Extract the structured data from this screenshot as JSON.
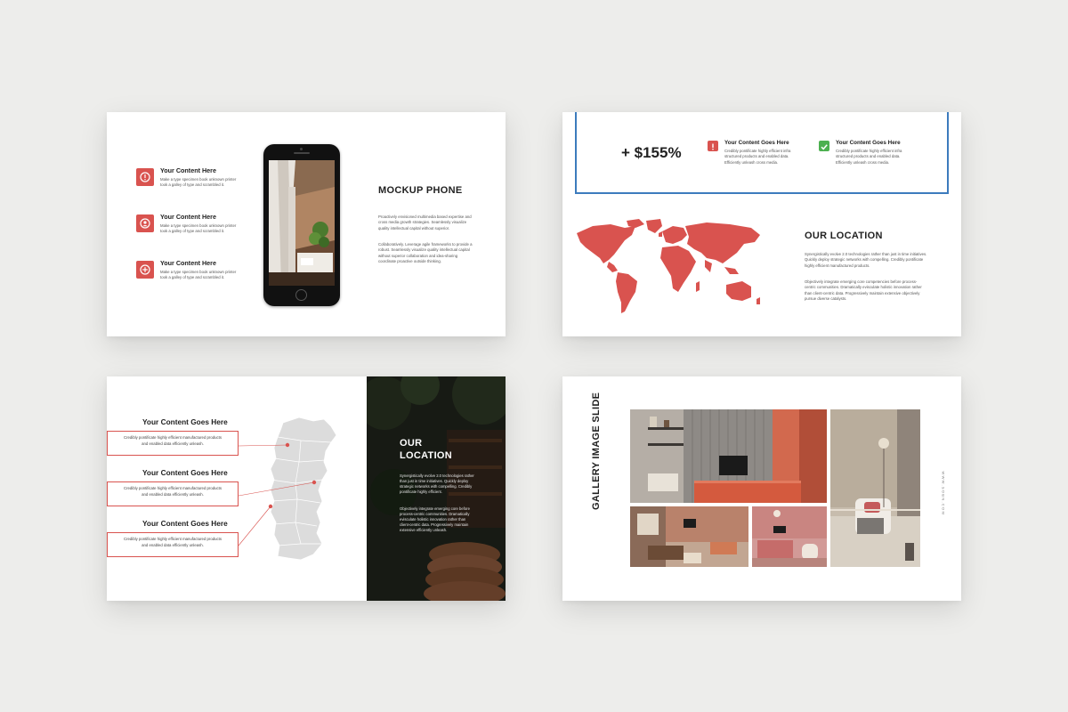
{
  "slide_mockup": {
    "items": [
      {
        "title": "Your Content Here",
        "text_line1": "Make a type specimen book unknown printer",
        "text_line2": "took a galley of type and scrambled it.",
        "icon": "exclamation-icon"
      },
      {
        "title": "Your Content Here",
        "text_line1": "Make a type specimen book unknown printer",
        "text_line2": "took a galley of type and scrambled it.",
        "icon": "user-icon"
      },
      {
        "title": "Your Content Here",
        "text_line1": "Make a type specimen book unknown printer",
        "text_line2": "took a galley of type and scrambled it.",
        "icon": "plus-icon"
      }
    ],
    "heading": "MOCKUP PHONE",
    "para1": [
      "Proactively envisioned multimedia based expertise and",
      "cross media growth strategies. Seamlessly visualize",
      "quality intellectual capital without superior."
    ],
    "para2": [
      "Collaboratively. Leverage agile frameworks to provide a",
      "robust. Seamlessly visualize quality intellectual capital",
      "without superior collaboration and idea-sharing",
      "coordinate proactive outside thinking."
    ]
  },
  "slide_location_world": {
    "stat": "+ $155%",
    "items": [
      {
        "title": "Your Content Goes Here",
        "lines": [
          "Credibly pontificate highly efficient infra",
          "structured products and enabled data.",
          "Efficiently unleash cross media."
        ],
        "icon": "alert-icon"
      },
      {
        "title": "Your Content Goes Here",
        "lines": [
          "Credibly pontificate highly efficient infra",
          "structured products and enabled data.",
          "Efficiently unleash cross media."
        ],
        "icon": "check-icon"
      }
    ],
    "heading": "OUR LOCATION",
    "para1": [
      "Synergistically evolve 2.0 technologies rather than just in time initiatives.",
      "Quickly deploy strategic networks with compelling. Credibly pontificate",
      "highly efficient manufactured products."
    ],
    "para2": [
      "Objectively integrate emerging core competencies before process-",
      "centric communities. Dramatically evisculate holistic innovation rather",
      "than client-centric data. Progressively maintain extensive objectively",
      "pursue diverse catalysts."
    ]
  },
  "slide_location_map": {
    "items": [
      {
        "title": "Your Content Goes Here",
        "line1": "Credibly pontificate highly efficient manufactured products",
        "line2": "and enabled data efficiently unleash."
      },
      {
        "title": "Your Content Goes Here",
        "line1": "Credibly pontificate highly efficient manufactured products",
        "line2": "and enabled data efficiently unleash."
      },
      {
        "title": "Your Content Goes Here",
        "line1": "Credibly pontificate highly efficient manufactured products",
        "line2": "and enabled data efficiently unleash."
      }
    ],
    "heading_line1": "OUR",
    "heading_line2": "LOCATION",
    "para1": [
      "Synergistically evolve 2.0 technologies rather",
      "than just in time initiatives. Quickly deploy",
      "strategic networks with compelling. Credibly",
      "pontificate highly efficient."
    ],
    "para2": [
      "Objectively integrate emerging core before",
      "process-centric communities. Dramatically",
      "evisculate holistic innovation rather than",
      "client-centric data. Progressively maintain",
      "extensive efficiently unleash."
    ]
  },
  "slide_gallery": {
    "title": "GALLERY IMAGE SLIDE",
    "url": "WWW.SOBN.COM"
  },
  "colors": {
    "accent_red": "#d9534f",
    "accent_blue": "#3c7bbd",
    "accent_green": "#4cb050"
  }
}
